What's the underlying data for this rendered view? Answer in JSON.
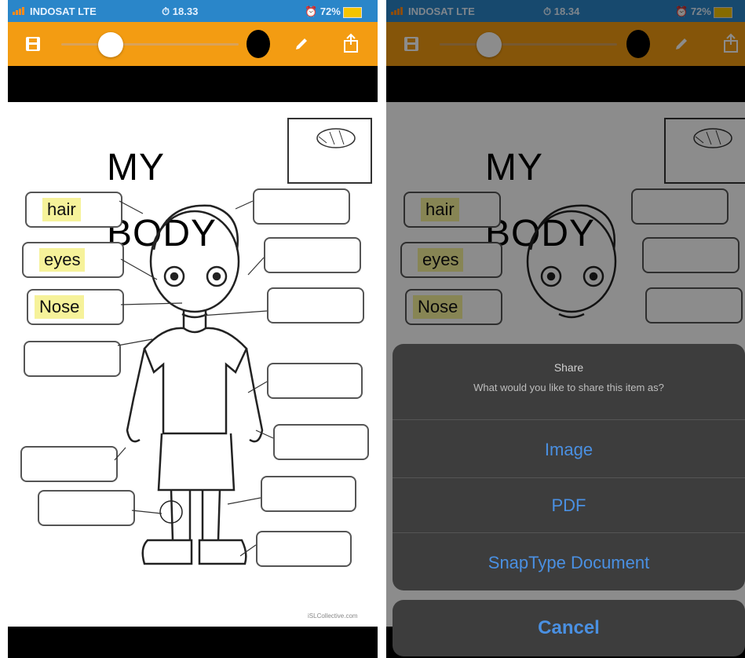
{
  "left_screen": {
    "status": {
      "carrier": "INDOSAT  LTE",
      "time": "18.33",
      "battery": "72%"
    },
    "worksheet": {
      "title_line1": "MY",
      "title_line2": "BODY",
      "labels": {
        "hair": "hair",
        "eyes": "eyes",
        "nose": "Nose"
      },
      "credit": "iSLCollective.com"
    }
  },
  "right_screen": {
    "status": {
      "carrier": "INDOSAT  LTE",
      "time": "18.34",
      "battery": "72%"
    },
    "worksheet": {
      "title_line1": "MY",
      "title_line2": "BODY",
      "labels": {
        "hair": "hair",
        "eyes": "eyes",
        "nose": "Nose"
      }
    },
    "share_sheet": {
      "title": "Share",
      "subtitle": "What would you like to share this item as?",
      "options": [
        "Image",
        "PDF",
        "SnapType Document"
      ],
      "cancel": "Cancel"
    }
  },
  "colors": {
    "toolbar": "#f39c12",
    "status_bar": "#2a86c9",
    "highlight": "#f6f29a",
    "ios_blue": "#4a90e2"
  }
}
